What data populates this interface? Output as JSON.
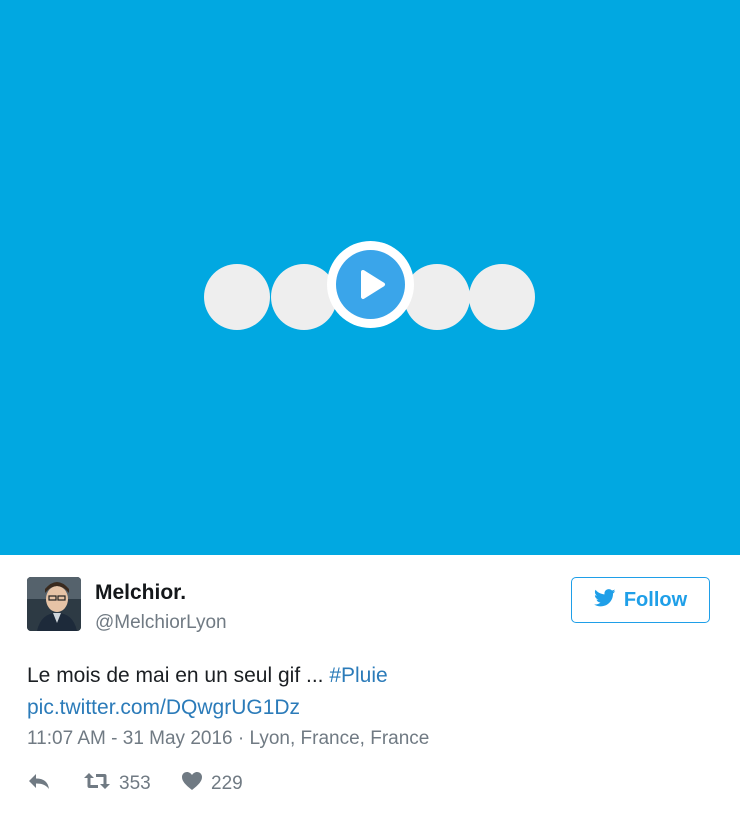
{
  "media": {
    "background_color": "#01a8e1",
    "play_icon": "play-icon"
  },
  "tweet": {
    "author_name": "Melchior.",
    "author_handle": "@MelchiorLyon",
    "follow_label": "Follow",
    "text_main": "Le mois de mai en un seul gif ... ",
    "hashtag": "#Pluie",
    "link": "pic.twitter.com/DQwgrUG1Dz",
    "meta": "11:07 AM - 31 May 2016 · Lyon, France, France",
    "retweet_count": "353",
    "like_count": "229"
  },
  "icons": {
    "reply": "reply-icon",
    "retweet": "retweet-icon",
    "like": "heart-icon",
    "follow": "twitter-bird-icon"
  },
  "colors": {
    "accent": "#1f9fe8",
    "link": "#2b7bb9",
    "muted": "#707a83"
  }
}
